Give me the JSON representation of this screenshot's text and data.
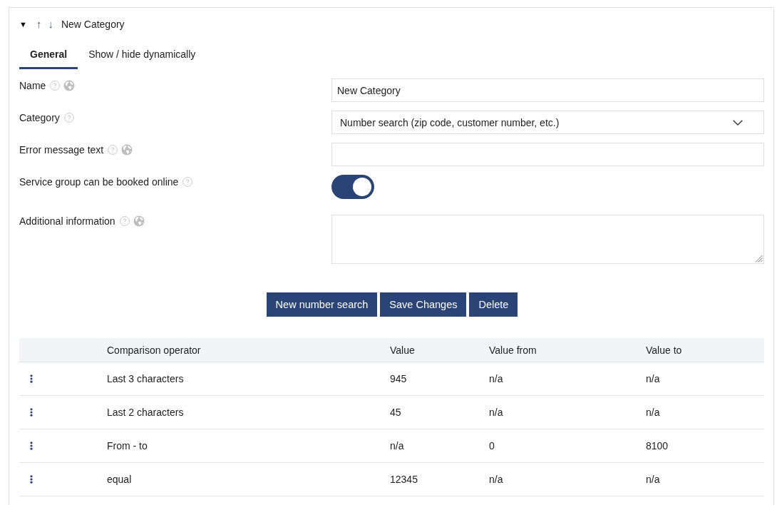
{
  "category_header": {
    "toggle": "▼",
    "move_up": "↑",
    "move_down": "↓",
    "title": "New Category"
  },
  "tabs": [
    {
      "label": "General",
      "selected": true
    },
    {
      "label": "Show / hide dynamically",
      "selected": false
    }
  ],
  "fields": [
    {
      "kind": "text",
      "label": "Name",
      "help": true,
      "translatable": true,
      "value": "New Category"
    },
    {
      "kind": "select",
      "label": "Category",
      "help": true,
      "value": "Number search (zip code, customer number, etc.)"
    },
    {
      "kind": "text",
      "label": "Error message text",
      "help": true,
      "translatable": true
    },
    {
      "kind": "toggle",
      "label": "Service group can be booked online",
      "help": true,
      "on": true
    },
    {
      "kind": "textarea",
      "label": "Additional information",
      "help": true,
      "translatable": true
    }
  ],
  "buttons": [
    "New number search",
    "Save Changes",
    "Delete"
  ],
  "table": {
    "columns": [
      "Comparison operator",
      "Value",
      "Value from",
      "Value to"
    ],
    "rows": [
      {
        "cells": [
          "Last 3 characters",
          "945",
          "n/a",
          "n/a"
        ]
      },
      {
        "cells": [
          "Last 2 characters",
          "45",
          "n/a",
          "n/a"
        ]
      },
      {
        "cells": [
          "From - to",
          "n/a",
          "0",
          "8100"
        ]
      },
      {
        "cells": [
          "equal",
          "12345",
          "n/a",
          "n/a"
        ]
      }
    ]
  }
}
